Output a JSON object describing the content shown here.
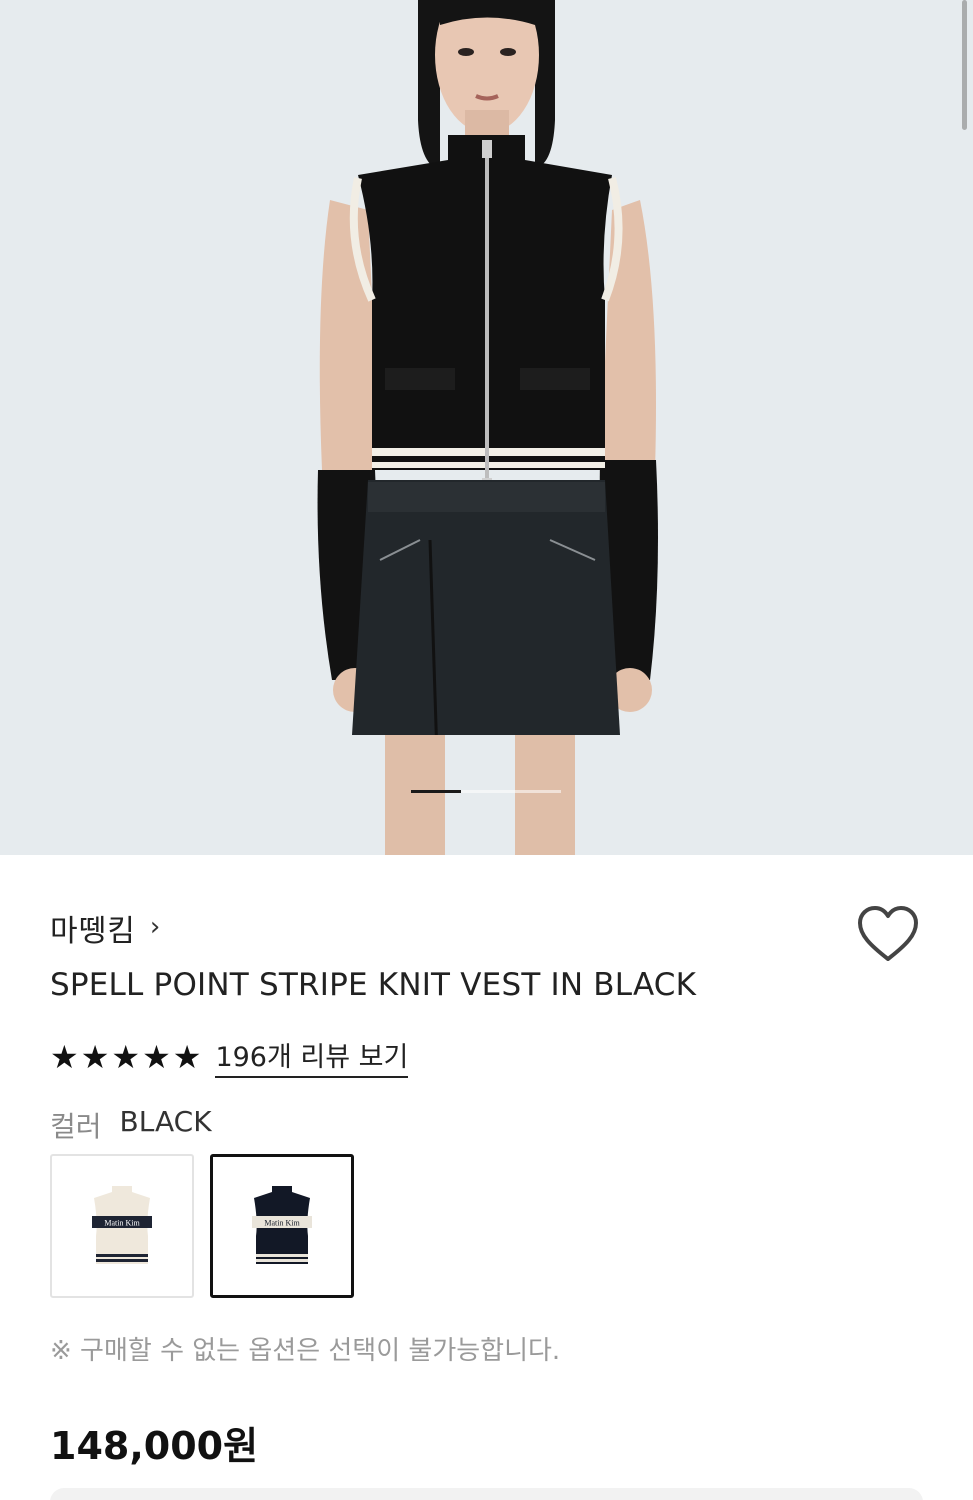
{
  "product": {
    "brand": "마뗑킴",
    "brand_chevron": "›",
    "title": "SPELL POINT STRIPE KNIT VEST IN BLACK",
    "rating_stars": 5,
    "review_link": "196개 리뷰 보기",
    "color_label": "컬러",
    "color_value": "BLACK",
    "swatches": [
      {
        "name": "IVORY",
        "selected": false,
        "logo_text": "Matin Kim"
      },
      {
        "name": "BLACK",
        "selected": true,
        "logo_text": "Matin Kim"
      }
    ],
    "notice": "※ 구매할 수 없는 옵션은 선택이 불가능합니다.",
    "price": "148,000원"
  },
  "gallery": {
    "total": 3,
    "active": 1
  },
  "colors": {
    "hero_background": "#e6ebee",
    "text_primary": "#222222",
    "text_muted": "#9a9a9a"
  }
}
